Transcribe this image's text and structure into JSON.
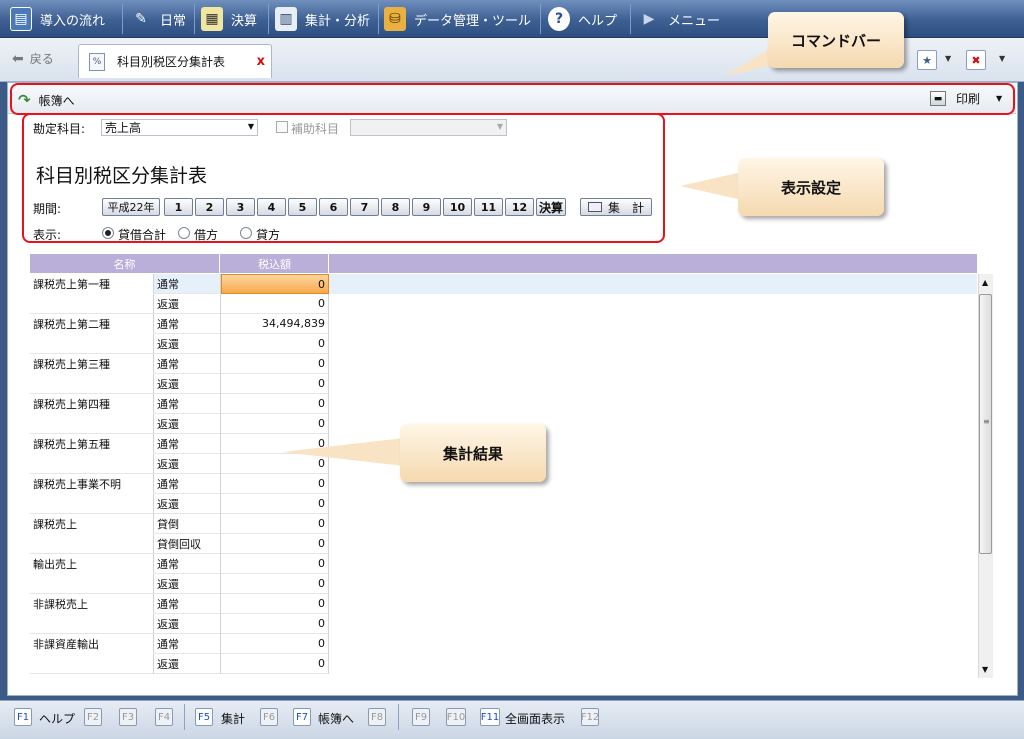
{
  "menu": {
    "items": [
      {
        "label": "導入の流れ"
      },
      {
        "label": "日常"
      },
      {
        "label": "決算"
      },
      {
        "label": "集計・分析"
      },
      {
        "label": "データ管理・ツール"
      },
      {
        "label": "ヘルプ"
      },
      {
        "label": "メニュー"
      }
    ]
  },
  "tabbar": {
    "back_label": "戻る",
    "tab_label": "科目別税区分集計表",
    "close_glyph": "x"
  },
  "command_bar": {
    "ledger_label": "帳簿へ",
    "print_label": "印刷"
  },
  "settings": {
    "account_label": "勘定科目:",
    "account_value": "売上高",
    "sub_account_label": "補助科目",
    "report_title": "科目別税区分集計表",
    "period_label": "期間:",
    "period_year": "平成22年",
    "months": [
      "1",
      "2",
      "3",
      "4",
      "5",
      "6",
      "7",
      "8",
      "9",
      "10",
      "11",
      "12"
    ],
    "settlement": "決算",
    "aggregate_button": "集　計",
    "display_label": "表示:",
    "display_options": [
      {
        "label": "貸借合計",
        "selected": true
      },
      {
        "label": "借方",
        "selected": false
      },
      {
        "label": "貸方",
        "selected": false
      }
    ]
  },
  "table": {
    "headers": [
      "名称",
      "税込額"
    ],
    "rows": [
      {
        "name": "課税売上第一種",
        "type": "通常",
        "amount": "0"
      },
      {
        "name": "",
        "type": "返還",
        "amount": "0"
      },
      {
        "name": "課税売上第二種",
        "type": "通常",
        "amount": "34,494,839"
      },
      {
        "name": "",
        "type": "返還",
        "amount": "0"
      },
      {
        "name": "課税売上第三種",
        "type": "通常",
        "amount": "0"
      },
      {
        "name": "",
        "type": "返還",
        "amount": "0"
      },
      {
        "name": "課税売上第四種",
        "type": "通常",
        "amount": "0"
      },
      {
        "name": "",
        "type": "返還",
        "amount": "0"
      },
      {
        "name": "課税売上第五種",
        "type": "通常",
        "amount": "0"
      },
      {
        "name": "",
        "type": "返還",
        "amount": "0"
      },
      {
        "name": "課税売上事業不明",
        "type": "通常",
        "amount": "0"
      },
      {
        "name": "",
        "type": "返還",
        "amount": "0"
      },
      {
        "name": "課税売上",
        "type": "貸倒",
        "amount": "0"
      },
      {
        "name": "",
        "type": "貸倒回収",
        "amount": "0"
      },
      {
        "name": "輸出売上",
        "type": "通常",
        "amount": "0"
      },
      {
        "name": "",
        "type": "返還",
        "amount": "0"
      },
      {
        "name": "非課税売上",
        "type": "通常",
        "amount": "0"
      },
      {
        "name": "",
        "type": "返還",
        "amount": "0"
      },
      {
        "name": "非課資産輸出",
        "type": "通常",
        "amount": "0"
      },
      {
        "name": "",
        "type": "返還",
        "amount": "0"
      }
    ]
  },
  "callouts": {
    "command_bar": "コマンドバー",
    "display_settings": "表示設定",
    "results": "集計結果"
  },
  "function_keys": [
    {
      "key": "F1",
      "label": "ヘルプ",
      "enabled": true
    },
    {
      "key": "F2",
      "label": "",
      "enabled": false
    },
    {
      "key": "F3",
      "label": "",
      "enabled": false
    },
    {
      "key": "F4",
      "label": "",
      "enabled": false
    },
    {
      "key": "F5",
      "label": "集計",
      "enabled": true
    },
    {
      "key": "F6",
      "label": "",
      "enabled": false
    },
    {
      "key": "F7",
      "label": "帳簿へ",
      "enabled": true
    },
    {
      "key": "F8",
      "label": "",
      "enabled": false
    },
    {
      "key": "F9",
      "label": "",
      "enabled": false
    },
    {
      "key": "F10",
      "label": "",
      "enabled": false
    },
    {
      "key": "F11",
      "label": "全画面表示",
      "enabled": true
    },
    {
      "key": "F12",
      "label": "",
      "enabled": false
    }
  ],
  "icons": {
    "menu": [
      "intro-flow-icon",
      "daily-icon",
      "closing-icon",
      "analysis-icon",
      "data-tools-icon",
      "help-icon",
      "menu-arrow-icon"
    ]
  },
  "colors": {
    "highlight": "#e8121a",
    "header": "#b9afd8",
    "menubar": "#3d5f92"
  }
}
